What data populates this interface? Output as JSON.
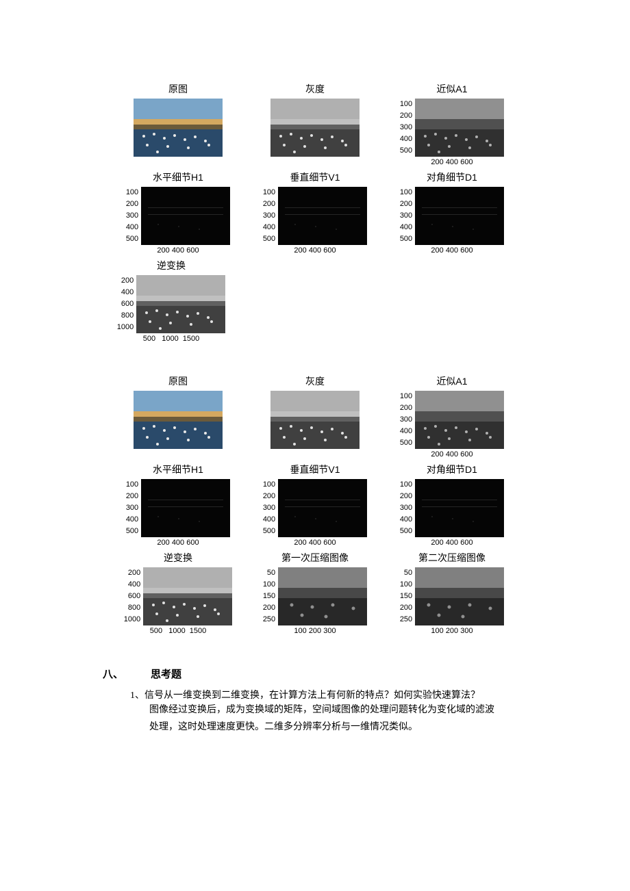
{
  "figures": {
    "set1": {
      "row1": [
        {
          "title": "原图",
          "type": "color",
          "yaxis": [],
          "xaxis": ""
        },
        {
          "title": "灰度",
          "type": "gray",
          "yaxis": [],
          "xaxis": ""
        },
        {
          "title": "近似A1",
          "type": "approx",
          "yaxis": [
            "100",
            "200",
            "300",
            "400",
            "500"
          ],
          "xaxis": "200 400 600"
        }
      ],
      "row2": [
        {
          "title": "水平细节H1",
          "type": "dark",
          "yaxis": [
            "100",
            "200",
            "300",
            "400",
            "500"
          ],
          "xaxis": "200 400 600"
        },
        {
          "title": "垂直细节V1",
          "type": "dark",
          "yaxis": [
            "100",
            "200",
            "300",
            "400",
            "500"
          ],
          "xaxis": "200 400 600"
        },
        {
          "title": "对角细节D1",
          "type": "dark",
          "yaxis": [
            "100",
            "200",
            "300",
            "400",
            "500"
          ],
          "xaxis": "200 400 600"
        }
      ],
      "row3": [
        {
          "title": "逆变换",
          "type": "inv",
          "yaxis": [
            "200",
            "400",
            "600",
            "800",
            "1000"
          ],
          "xaxis": "500   1000  1500"
        }
      ]
    },
    "set2": {
      "row1": [
        {
          "title": "原图",
          "type": "color",
          "yaxis": [],
          "xaxis": ""
        },
        {
          "title": "灰度",
          "type": "gray",
          "yaxis": [],
          "xaxis": ""
        },
        {
          "title": "近似A1",
          "type": "approx",
          "yaxis": [
            "100",
            "200",
            "300",
            "400",
            "500"
          ],
          "xaxis": "200 400 600"
        }
      ],
      "row2": [
        {
          "title": "水平细节H1",
          "type": "dark",
          "yaxis": [
            "100",
            "200",
            "300",
            "400",
            "500"
          ],
          "xaxis": "200 400 600"
        },
        {
          "title": "垂直细节V1",
          "type": "dark",
          "yaxis": [
            "100",
            "200",
            "300",
            "400",
            "500"
          ],
          "xaxis": "200 400 600"
        },
        {
          "title": "对角细节D1",
          "type": "dark",
          "yaxis": [
            "100",
            "200",
            "300",
            "400",
            "500"
          ],
          "xaxis": "200 400 600"
        }
      ],
      "row3": [
        {
          "title": "逆变换",
          "type": "inv",
          "yaxis": [
            "200",
            "400",
            "600",
            "800",
            "1000"
          ],
          "xaxis": "500   1000  1500"
        },
        {
          "title": "第一次压缩图像",
          "type": "comp1",
          "yaxis": [
            "50",
            "100",
            "150",
            "200",
            "250"
          ],
          "xaxis": "100 200 300"
        },
        {
          "title": "第二次压缩图像",
          "type": "comp2",
          "yaxis": [
            "50",
            "100",
            "150",
            "200",
            "250"
          ],
          "xaxis": "100 200 300"
        }
      ]
    }
  },
  "section": {
    "num": "八、",
    "title": "思考题",
    "q_num": "1、",
    "q_text": "信号从一维变换到二维变换，在计算方法上有何新的特点？如何实验快速算法？",
    "q_body1": "图像经过变换后，成为变换域的矩阵，空间域图像的处理问题转化为变化域的滤波",
    "q_body2": "处理，这时处理速度更快。二维多分辨率分析与一维情况类似。"
  }
}
